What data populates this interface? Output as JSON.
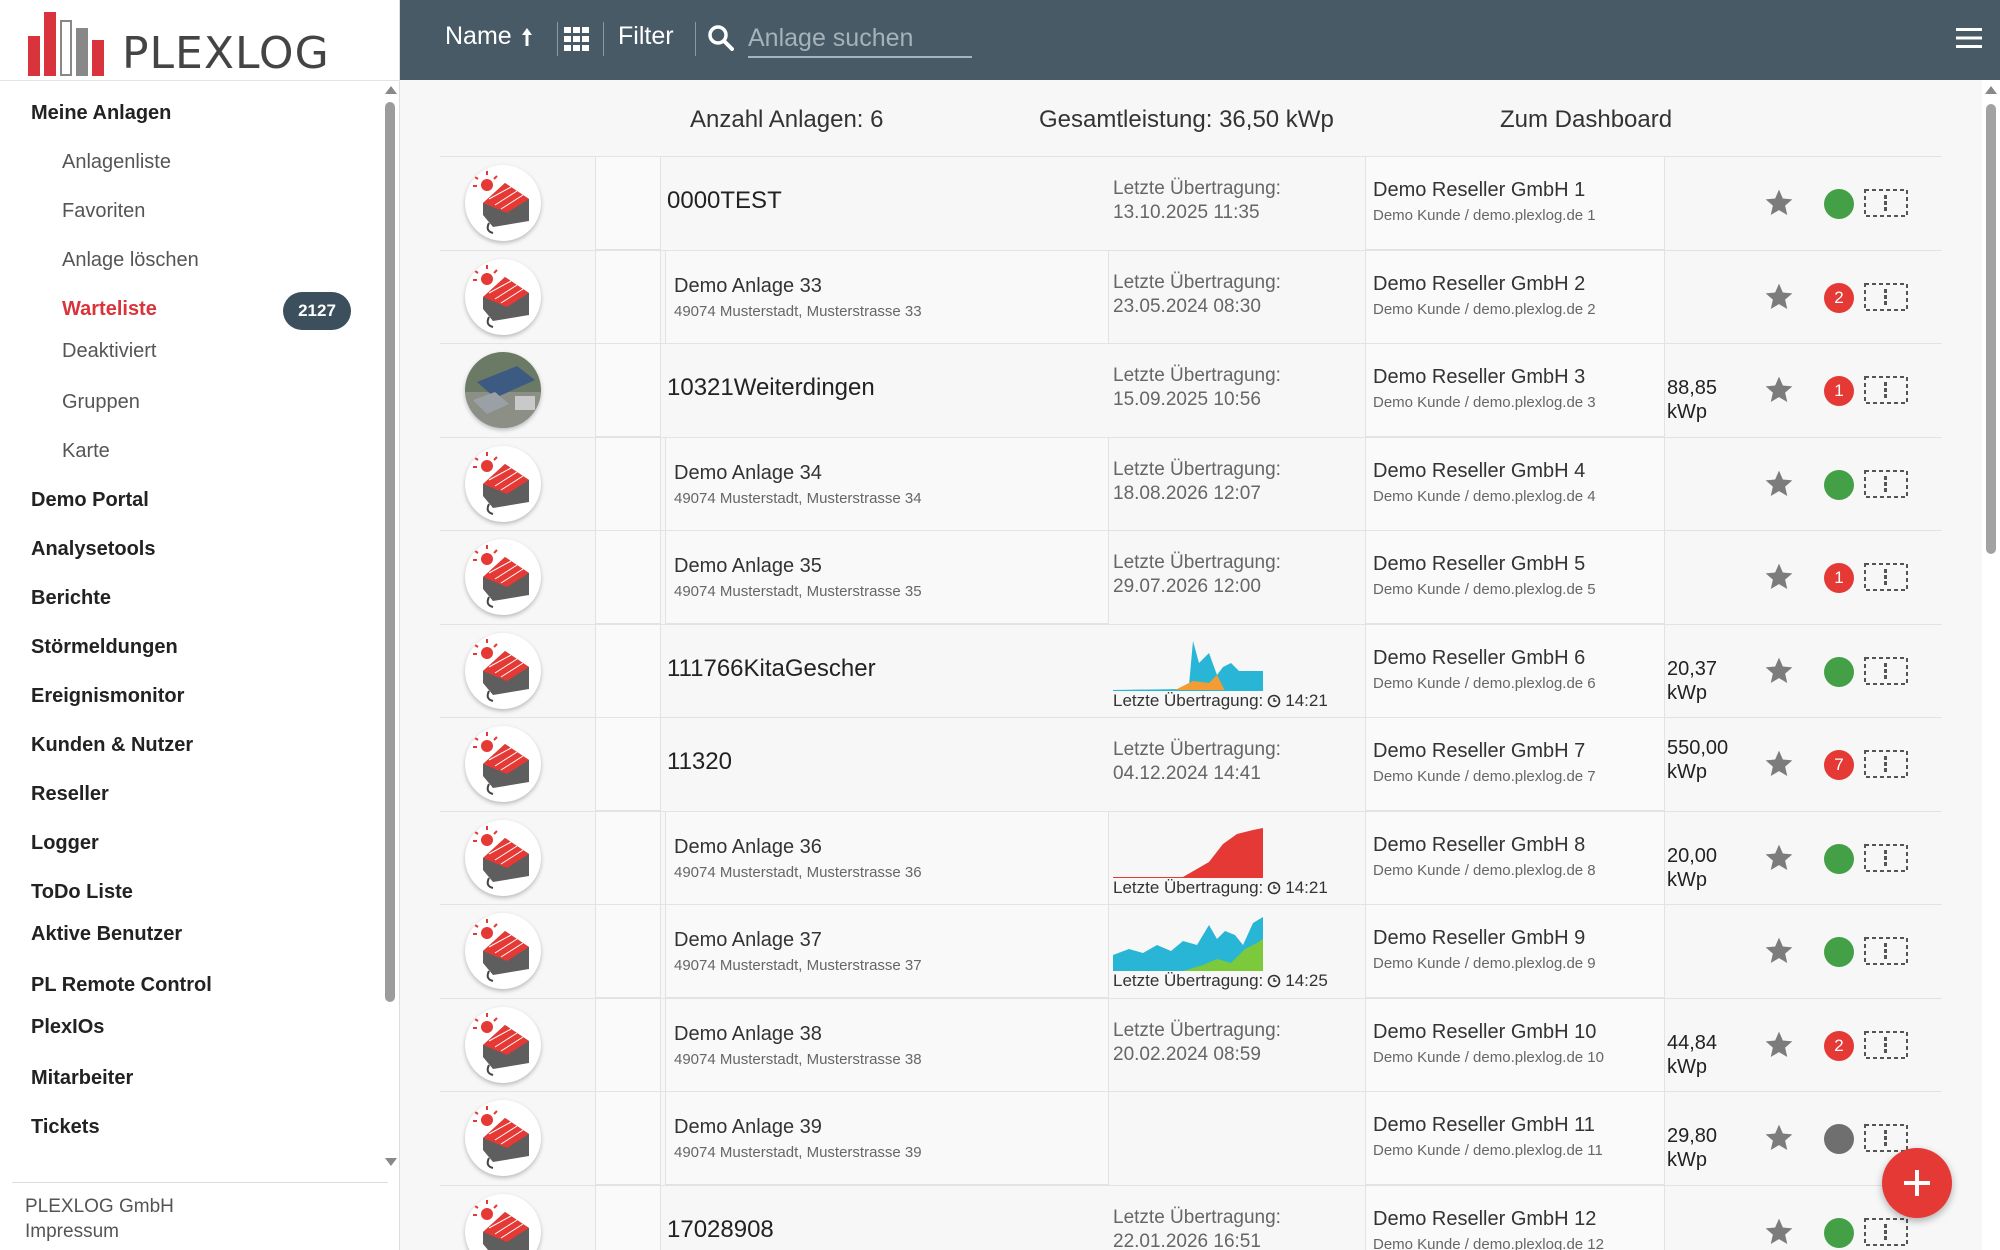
{
  "brand": {
    "name": "PLEXLOG",
    "colors": {
      "red": "#d9343b",
      "dark": "#485a66",
      "grey": "#8d8d8d"
    }
  },
  "sidebar": {
    "items": [
      {
        "label": "Meine Anlagen",
        "level": 0
      },
      {
        "label": "Anlagenliste",
        "level": 1
      },
      {
        "label": "Favoriten",
        "level": 1
      },
      {
        "label": "Anlage löschen",
        "level": 1
      },
      {
        "label": "Warteliste",
        "level": 1,
        "active": true,
        "badge": "2127"
      },
      {
        "label": "Deaktiviert",
        "level": 1
      },
      {
        "label": "Gruppen",
        "level": 1
      },
      {
        "label": "Karte",
        "level": 1
      },
      {
        "label": "Demo Portal",
        "level": 0
      },
      {
        "label": "Analysetools",
        "level": 0
      },
      {
        "label": "Berichte",
        "level": 0
      },
      {
        "label": "Störmeldungen",
        "level": 0
      },
      {
        "label": "Ereignismonitor",
        "level": 0
      },
      {
        "label": "Kunden & Nutzer",
        "level": 0
      },
      {
        "label": "Reseller",
        "level": 0
      },
      {
        "label": "Logger",
        "level": 0
      },
      {
        "label": "ToDo Liste",
        "level": 0
      },
      {
        "label": "Aktive Benutzer",
        "level": 0
      },
      {
        "label": "PL Remote Control",
        "level": 0
      },
      {
        "label": "PlexIOs",
        "level": 0
      },
      {
        "label": "Mitarbeiter",
        "level": 0
      },
      {
        "label": "Tickets",
        "level": 0
      }
    ],
    "footer": {
      "company": "PLEXLOG GmbH",
      "imprint": "Impressum"
    }
  },
  "header": {
    "sort_label": "Name",
    "sort_icon": "arrow-up-icon",
    "view_icon": "grid-icon",
    "filter_label": "Filter",
    "search_placeholder": "Anlage suchen",
    "menu_icon": "hamburger-menu-icon"
  },
  "summary": {
    "count": "Anzahl Anlagen: 6",
    "total": "Gesamtleistung: 36,50 kWp",
    "dashboard": "Zum Dashboard"
  },
  "rows": [
    {
      "avatar": "house-icon",
      "name": "0000TEST",
      "address": "",
      "tx1": "Letzte Übertragung:",
      "tx2": "13.10.2025 11:35",
      "chart": "",
      "reseller": "Demo Reseller GmbH 1",
      "customer": "Demo Kunde / demo.plexlog.de 1",
      "kwp": "",
      "status": "green",
      "status_text": ""
    },
    {
      "avatar": "house-icon",
      "name": "Demo Anlage 33",
      "address": "49074 Musterstadt, Musterstrasse 33",
      "tx1": "Letzte Übertragung:",
      "tx2": "23.05.2024 08:30",
      "chart": "",
      "reseller": "Demo Reseller GmbH 2",
      "customer": "Demo Kunde / demo.plexlog.de 2",
      "kwp": "",
      "status": "red",
      "status_text": "2"
    },
    {
      "avatar": "aerial-photo",
      "name": "10321Weiterdingen",
      "address": "",
      "tx1": "Letzte Übertragung:",
      "tx2": "15.09.2025 10:56",
      "chart": "",
      "reseller": "Demo Reseller GmbH 3",
      "customer": "Demo Kunde / demo.plexlog.de 3",
      "kwp": "88,85 kWp",
      "status": "red",
      "status_text": "1"
    },
    {
      "avatar": "house-icon",
      "name": "Demo Anlage 34",
      "address": "49074 Musterstadt, Musterstrasse 34",
      "tx1": "Letzte Übertragung:",
      "tx2": "18.08.2026 12:07",
      "chart": "",
      "reseller": "Demo Reseller GmbH 4",
      "customer": "Demo Kunde / demo.plexlog.de 4",
      "kwp": "",
      "status": "green",
      "status_text": ""
    },
    {
      "avatar": "house-icon",
      "name": "Demo Anlage 35",
      "address": "49074 Musterstadt, Musterstrasse 35",
      "tx1": "Letzte Übertragung:",
      "tx2": "29.07.2026 12:00",
      "chart": "",
      "reseller": "Demo Reseller GmbH 5",
      "customer": "Demo Kunde / demo.plexlog.de 5",
      "kwp": "",
      "status": "red",
      "status_text": "1"
    },
    {
      "avatar": "house-icon",
      "name": "111766KitaGescher",
      "address": "",
      "tx1": "",
      "tx2": "",
      "chart": "blue",
      "chart_label": "Letzte Übertragung:",
      "chart_time": "14:21",
      "reseller": "Demo Reseller GmbH 6",
      "customer": "Demo Kunde / demo.plexlog.de 6",
      "kwp": "20,37 kWp",
      "status": "green",
      "status_text": ""
    },
    {
      "avatar": "house-icon",
      "name": "11320",
      "address": "",
      "tx1": "Letzte Übertragung:",
      "tx2": "04.12.2024 14:41",
      "chart": "",
      "reseller": "Demo Reseller GmbH 7",
      "customer": "Demo Kunde / demo.plexlog.de 7",
      "kwp": "550,00 kWp",
      "status": "red",
      "status_text": "7"
    },
    {
      "avatar": "house-icon",
      "name": "Demo Anlage 36",
      "address": "49074 Musterstadt, Musterstrasse 36",
      "tx1": "",
      "tx2": "",
      "chart": "red",
      "chart_label": "Letzte Übertragung:",
      "chart_time": "14:21",
      "reseller": "Demo Reseller GmbH 8",
      "customer": "Demo Kunde / demo.plexlog.de 8",
      "kwp": "20,00 kWp",
      "status": "green",
      "status_text": ""
    },
    {
      "avatar": "house-icon",
      "name": "Demo Anlage 37",
      "address": "49074 Musterstadt, Musterstrasse 37",
      "tx1": "",
      "tx2": "",
      "chart": "mixed",
      "chart_label": "Letzte Übertragung:",
      "chart_time": "14:25",
      "reseller": "Demo Reseller GmbH 9",
      "customer": "Demo Kunde / demo.plexlog.de 9",
      "kwp": "",
      "status": "green",
      "status_text": ""
    },
    {
      "avatar": "house-icon",
      "name": "Demo Anlage 38",
      "address": "49074 Musterstadt, Musterstrasse 38",
      "tx1": "Letzte Übertragung:",
      "tx2": "20.02.2024 08:59",
      "chart": "",
      "reseller": "Demo Reseller GmbH 10",
      "customer": "Demo Kunde / demo.plexlog.de 10",
      "kwp": "44,84 kWp",
      "status": "red",
      "status_text": "2"
    },
    {
      "avatar": "house-icon",
      "name": "Demo Anlage 39",
      "address": "49074 Musterstadt, Musterstrasse 39",
      "tx1": "",
      "tx2": "",
      "chart": "",
      "reseller": "Demo Reseller GmbH 11",
      "customer": "Demo Kunde / demo.plexlog.de 11",
      "kwp": "29,80 kWp",
      "status": "grey",
      "status_text": ""
    },
    {
      "avatar": "house-icon",
      "name": "17028908",
      "address": "",
      "tx1": "Letzte Übertragung:",
      "tx2": "22.01.2026 16:51",
      "chart": "",
      "reseller": "Demo Reseller GmbH 12",
      "customer": "Demo Kunde / demo.plexlog.de 12",
      "kwp": "",
      "status": "green",
      "status_text": ""
    }
  ],
  "fab_icon": "plus-icon"
}
